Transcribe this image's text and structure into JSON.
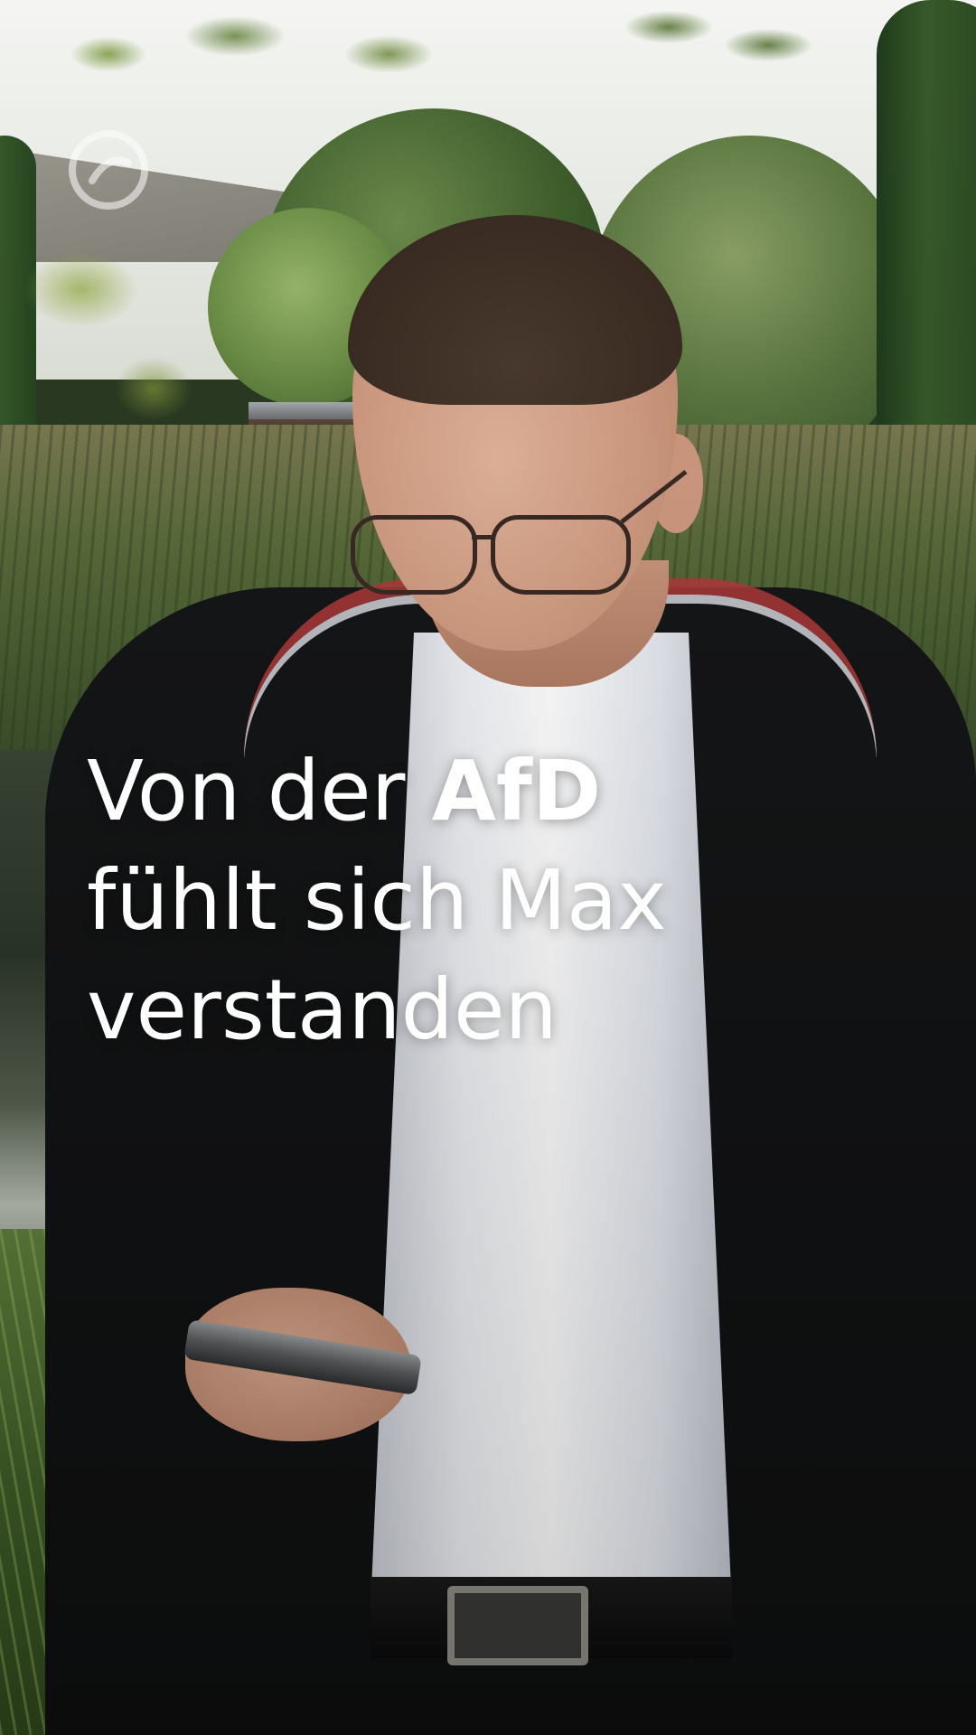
{
  "video": {
    "caption": {
      "line1_prefix": "Von der ",
      "line1_highlight": "AfD",
      "line2": "fühlt sich Max",
      "line3": "verstanden"
    },
    "logo_icon": "broadcaster-watermark-icon"
  },
  "colors": {
    "caption_text": "#ffffff"
  }
}
